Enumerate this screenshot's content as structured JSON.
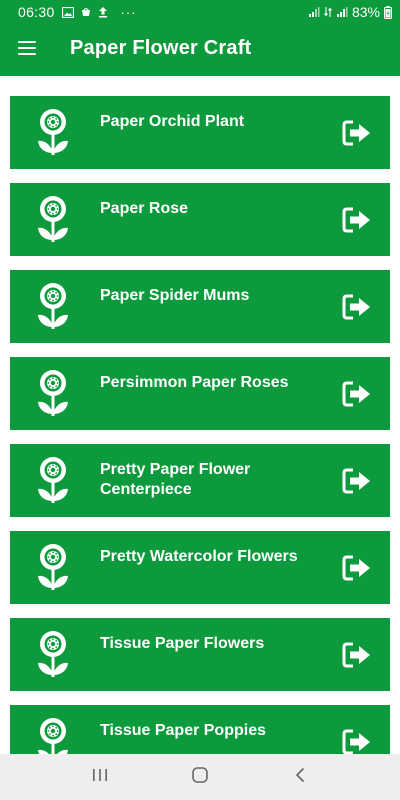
{
  "status_bar": {
    "time": "06:30",
    "more": "···",
    "battery": "83%",
    "icons": [
      "image-icon",
      "bag-icon",
      "upload-icon",
      "signal-icon",
      "data-icon",
      "signal-icon",
      "battery-charging-icon"
    ]
  },
  "app_bar": {
    "title": "Paper Flower Craft",
    "menu_icon": "hamburger-menu-icon"
  },
  "list": {
    "items": [
      {
        "label": "Paper Orchid Plant"
      },
      {
        "label": "Paper Rose"
      },
      {
        "label": "Paper Spider Mums"
      },
      {
        "label": "Persimmon Paper Roses"
      },
      {
        "label": "Pretty Paper Flower Centerpiece"
      },
      {
        "label": "Pretty Watercolor Flowers"
      },
      {
        "label": "Tissue Paper Flowers"
      },
      {
        "label": "Tissue Paper Poppies"
      }
    ],
    "item_icon": "flower-icon",
    "action_icon": "open-arrow-icon"
  },
  "nav_bar": {
    "icons": [
      "recent-apps-icon",
      "home-icon",
      "back-icon"
    ]
  },
  "colors": {
    "primary": "#0d9a3d",
    "on_primary": "#ffffff",
    "nav_background": "#eeeeee"
  }
}
